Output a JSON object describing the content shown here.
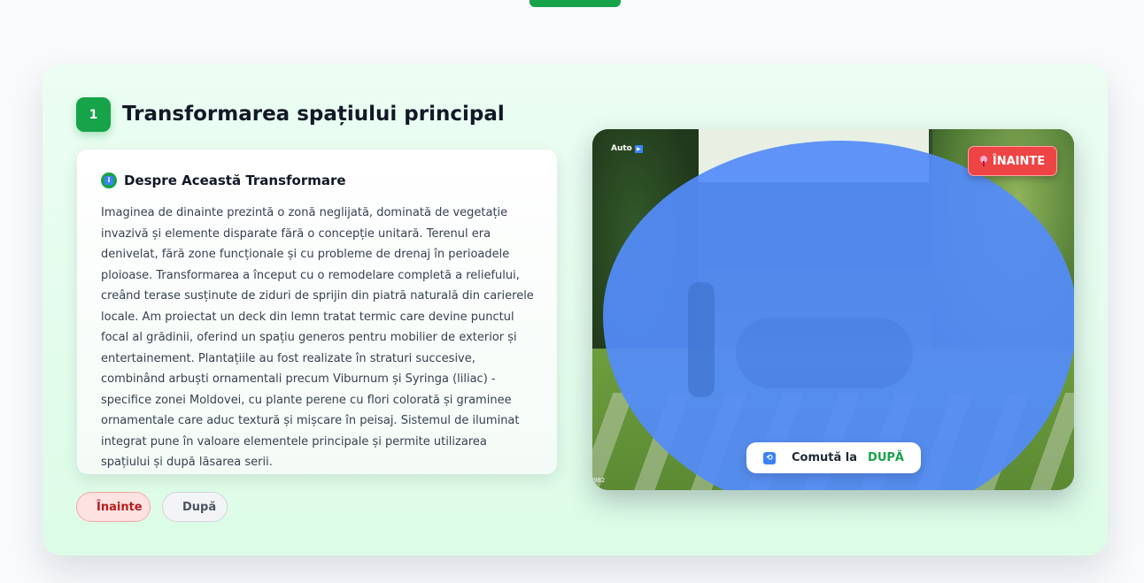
{
  "step": {
    "number": "1",
    "title": "Transformarea spațiului principal"
  },
  "about": {
    "heading": "Despre Această Transformare",
    "text": "Imaginea de dinainte prezintă o zonă neglijată, dominată de vegetație invazivă și elemente disparate fără o concepție unitară. Terenul era denivelat, fără zone funcționale și cu probleme de drenaj în perioadele ploioase. Transformarea a început cu o remodelare completă a reliefului, creând terase susținute de ziduri de sprijin din piatră naturală din carierele locale. Am proiectat un deck din lemn tratat termic care devine punctul focal al grădinii, oferind un spațiu generos pentru mobilier de exterior și entertainement. Plantațiile au fost realizate în straturi succesive, combinând arbuști ornamentali precum Viburnum și Syringa (liliac) - specifice zonei Moldovei, cu plante perene cu flori colorată și graminee ornamentale care aduc textură și mișcare în peisaj. Sistemul de iluminat integrat pune în valoare elementele principale și permite utilizarea spațiului și după lăsarea serii."
  },
  "pills": {
    "before_label": "Înainte",
    "after_label": "După"
  },
  "viewer": {
    "auto_label": "Auto",
    "state_badge": "ÎNAINTE",
    "toggle_prefix": "Comută la",
    "toggle_target": "DUPĂ",
    "caption": "982"
  },
  "colors": {
    "accent": "#16a34a",
    "before": "#ef4444",
    "overlay": "#548cfa"
  },
  "icons": {
    "info": "info-icon",
    "play": "play-icon",
    "pin": "pin-icon",
    "swap": "swap-icon"
  }
}
